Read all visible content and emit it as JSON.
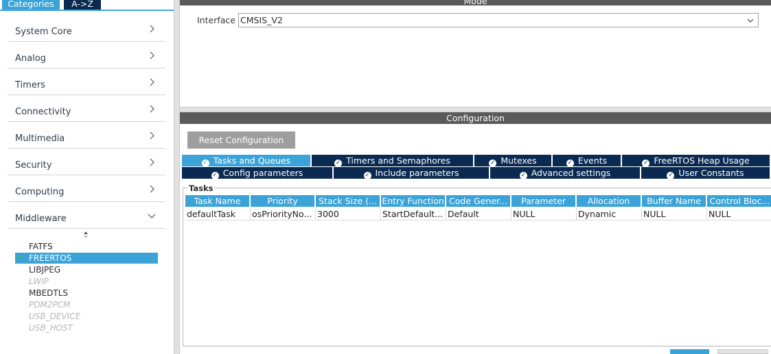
{
  "left_panel": {
    "tabs": {
      "categories": "Categories",
      "az": "A->Z"
    },
    "categories": [
      {
        "label": "System Core",
        "state": "collapsed"
      },
      {
        "label": "Analog",
        "state": "collapsed"
      },
      {
        "label": "Timers",
        "state": "collapsed"
      },
      {
        "label": "Connectivity",
        "state": "collapsed"
      },
      {
        "label": "Multimedia",
        "state": "collapsed"
      },
      {
        "label": "Security",
        "state": "collapsed"
      },
      {
        "label": "Computing",
        "state": "collapsed"
      },
      {
        "label": "Middleware",
        "state": "expanded"
      }
    ],
    "middleware_items": [
      {
        "label": "FATFS",
        "enabled": true,
        "selected": false,
        "checked": false
      },
      {
        "label": "FREERTOS",
        "enabled": true,
        "selected": true,
        "checked": true
      },
      {
        "label": "LIBJPEG",
        "enabled": true,
        "selected": false,
        "checked": false
      },
      {
        "label": "LWIP",
        "enabled": false,
        "selected": false,
        "checked": false
      },
      {
        "label": "MBEDTLS",
        "enabled": true,
        "selected": false,
        "checked": false
      },
      {
        "label": "PDM2PCM",
        "enabled": false,
        "selected": false,
        "checked": false
      },
      {
        "label": "USB_DEVICE",
        "enabled": false,
        "selected": false,
        "checked": false
      },
      {
        "label": "USB_HOST",
        "enabled": false,
        "selected": false,
        "checked": false
      }
    ]
  },
  "mode": {
    "header": "Mode",
    "interface_label": "Interface",
    "interface_value": "CMSIS_V2"
  },
  "configuration": {
    "header": "Configuration",
    "reset_button": "Reset Configuration",
    "tabs_row1": [
      "Tasks and Queues",
      "Timers and Semaphores",
      "Mutexes",
      "Events",
      "FreeRTOS Heap Usage"
    ],
    "tabs_row2": [
      "Config parameters",
      "Include parameters",
      "Advanced settings",
      "User Constants"
    ],
    "active_tab": "Tasks and Queues",
    "tasks": {
      "legend": "Tasks",
      "columns": [
        "Task Name",
        "Priority",
        "Stack Size (...",
        "Entry Function",
        "Code Gener...",
        "Parameter",
        "Allocation",
        "Buffer Name",
        "Control Bloc..."
      ],
      "rows": [
        [
          "defaultTask",
          "osPriorityNo...",
          "3000",
          "StartDefault...",
          "Default",
          "NULL",
          "Dynamic",
          "NULL",
          "NULL"
        ]
      ]
    }
  },
  "colors": {
    "accent": "#3ba3d8",
    "navy": "#0a2a52",
    "header_gray": "#5a5a5a",
    "button_gray": "#9e9e9e",
    "check_green": "#4caf50"
  }
}
